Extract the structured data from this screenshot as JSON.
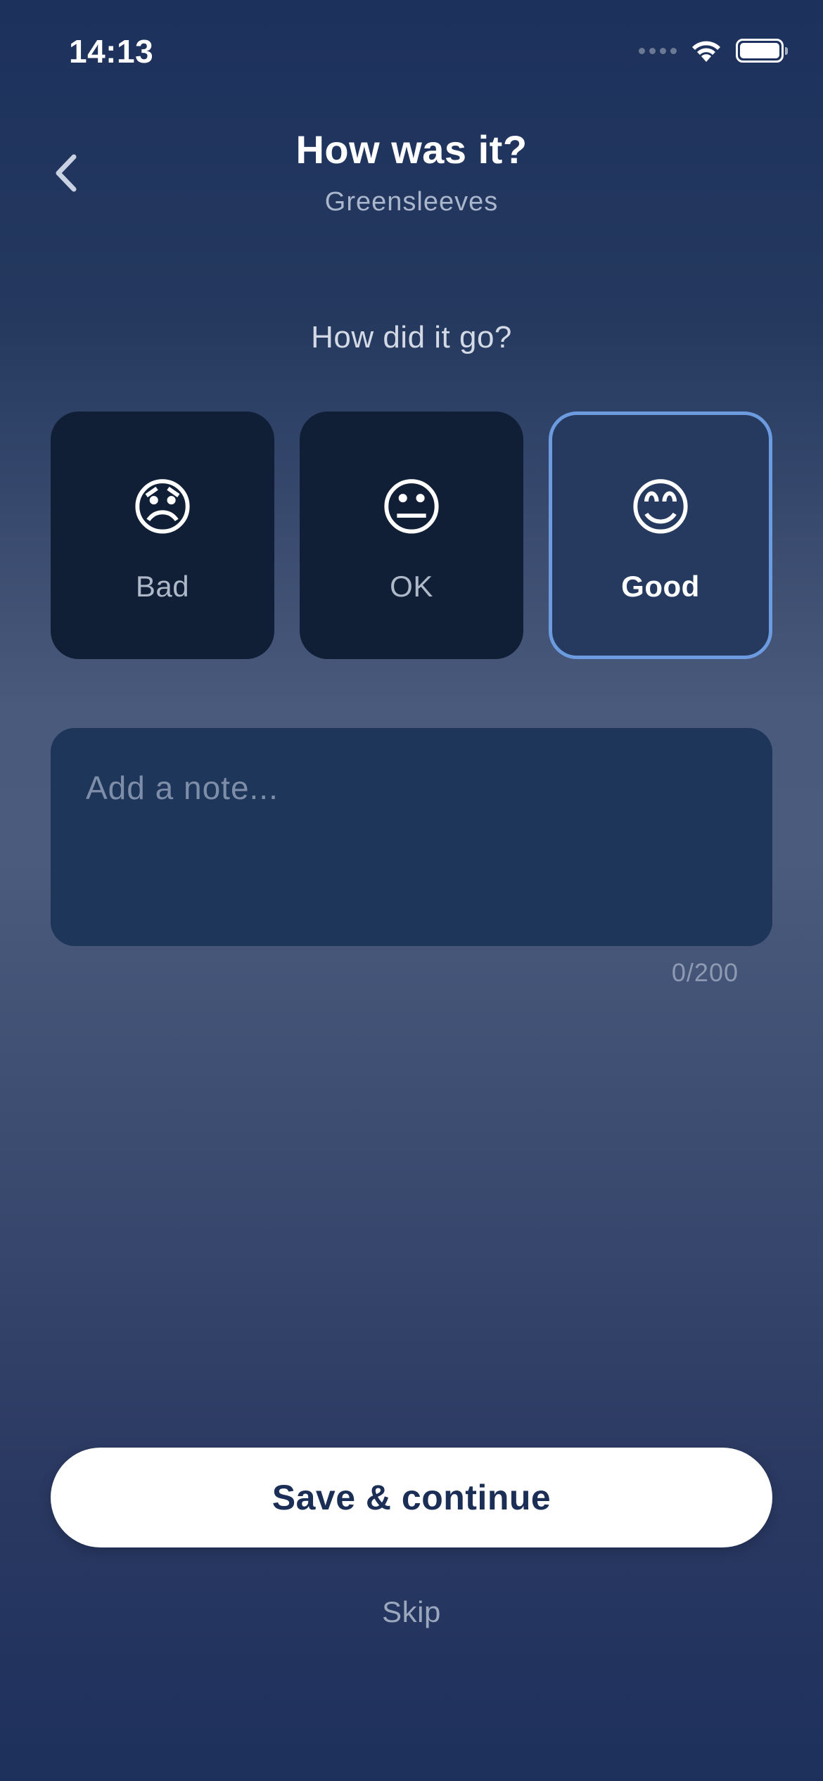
{
  "status_bar": {
    "time": "14:13",
    "signal_icon": "cellular-signal-icon",
    "wifi_icon": "wifi-icon",
    "battery_icon": "battery-icon"
  },
  "header": {
    "back_icon": "chevron-left-icon",
    "title": "How was it?",
    "subtitle": "Greensleeves"
  },
  "question": "How did it go?",
  "ratings": [
    {
      "emoji": "😞",
      "label": "Bad",
      "selected": false
    },
    {
      "emoji": "😐",
      "label": "OK",
      "selected": false
    },
    {
      "emoji": "😊",
      "label": "Good",
      "selected": true
    }
  ],
  "note": {
    "placeholder": "Add a note...",
    "value": "",
    "char_count": "0/200"
  },
  "actions": {
    "save_label": "Save & continue",
    "skip_label": "Skip"
  },
  "colors": {
    "selected_border": "#6c9be0",
    "card_bg": "#111f36",
    "selected_card_bg": "#263a5f",
    "note_bg": "#1e3659",
    "primary_button_bg": "#ffffff",
    "primary_button_text": "#1b2e55"
  }
}
